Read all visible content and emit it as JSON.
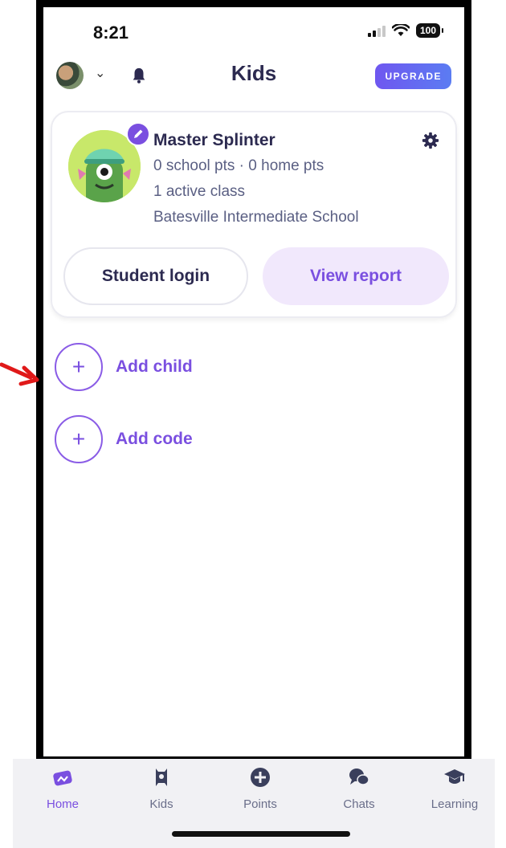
{
  "status_bar": {
    "time": "8:21",
    "battery": "100"
  },
  "header": {
    "title": "Kids",
    "upgrade_label": "UPGRADE",
    "icons": {
      "avatar": "profile-photo",
      "chevron": "chevron-down-icon",
      "bell": "bell-icon"
    }
  },
  "child_card": {
    "name": "Master Splinter",
    "points_line": "0 school pts · 0 home pts",
    "classes_line": "1 active class",
    "school_line": "Batesville Intermediate  School",
    "student_login_label": "Student login",
    "view_report_label": "View report"
  },
  "actions": {
    "add_child_label": "Add child",
    "add_code_label": "Add code",
    "plus_symbol": "+"
  },
  "tab_bar": {
    "tabs": [
      {
        "label": "Home",
        "icon": "home-icon",
        "active": true
      },
      {
        "label": "Kids",
        "icon": "kids-icon",
        "active": false
      },
      {
        "label": "Points",
        "icon": "plus-circle-icon",
        "active": false
      },
      {
        "label": "Chats",
        "icon": "chat-bubbles-icon",
        "active": false
      },
      {
        "label": "Learning",
        "icon": "graduation-cap-icon",
        "active": false
      }
    ]
  },
  "colors": {
    "accent_purple": "#7a4fe0",
    "view_report_bg": "#f1e8fc",
    "title_text": "#2c2a50",
    "annotation_red": "#e01919"
  }
}
